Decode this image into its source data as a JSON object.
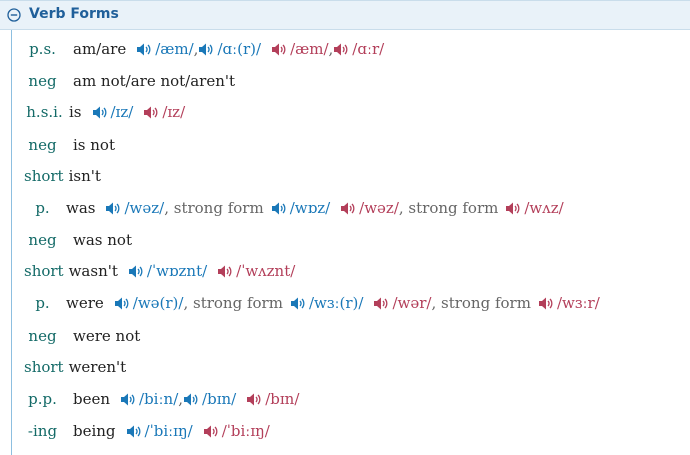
{
  "header": {
    "title": "Verb Forms",
    "collapse_icon": "circle-minus-icon"
  },
  "colors": {
    "label": "#136a67",
    "uk_pron": "#1a78b8",
    "us_pron": "#b33f5a",
    "header_bg": "#e9f2f9",
    "header_text": "#1f5f9a"
  },
  "icons": {
    "pronunciation": "speaker-icon"
  },
  "rows": {
    "ps": {
      "label": "p.s.",
      "word": "am/are",
      "uk1": "/æm/",
      "uk_sep": ",",
      "uk2": "/ɑː(r)/",
      "us1": "/æm/",
      "us_sep": ",",
      "us2": "/ɑːr/"
    },
    "ps_neg": {
      "label": "neg",
      "word": "am not/are not/aren't"
    },
    "hsi": {
      "label": "h.s.i.",
      "word": "is",
      "uk1": "/ɪz/",
      "us1": "/ɪz/"
    },
    "hsi_neg": {
      "label": "neg",
      "word": "is not"
    },
    "hsi_short": {
      "label": "short",
      "word": "isn't"
    },
    "p1": {
      "label": "p.",
      "word": "was",
      "uk1": "/wəz/",
      "uk_sep": ", strong form",
      "uk2": "/wɒz/",
      "us1": "/wəz/",
      "us_sep": ", strong form",
      "us2": "/wʌz/"
    },
    "p1_neg": {
      "label": "neg",
      "word": "was not"
    },
    "p1_short": {
      "label": "short",
      "word": "wasn't",
      "uk1": "/ˈwɒznt/",
      "us1": "/ˈwʌznt/"
    },
    "p2": {
      "label": "p.",
      "word": "were",
      "uk1": "/wə(r)/",
      "uk_sep": ", strong form",
      "uk2": "/wɜː(r)/",
      "us1": "/wər/",
      "us_sep": ", strong form",
      "us2": "/wɜːr/"
    },
    "p2_neg": {
      "label": "neg",
      "word": "were not"
    },
    "p2_short": {
      "label": "short",
      "word": "weren't"
    },
    "pp": {
      "label": "p.p.",
      "word": "been",
      "uk1": "/biːn/",
      "uk_sep": ",",
      "uk2": "/bɪn/",
      "us1": "/bɪn/"
    },
    "ing": {
      "label": "-ing",
      "word": "being",
      "uk1": "/ˈbiːɪŋ/",
      "us1": "/ˈbiːɪŋ/"
    }
  }
}
